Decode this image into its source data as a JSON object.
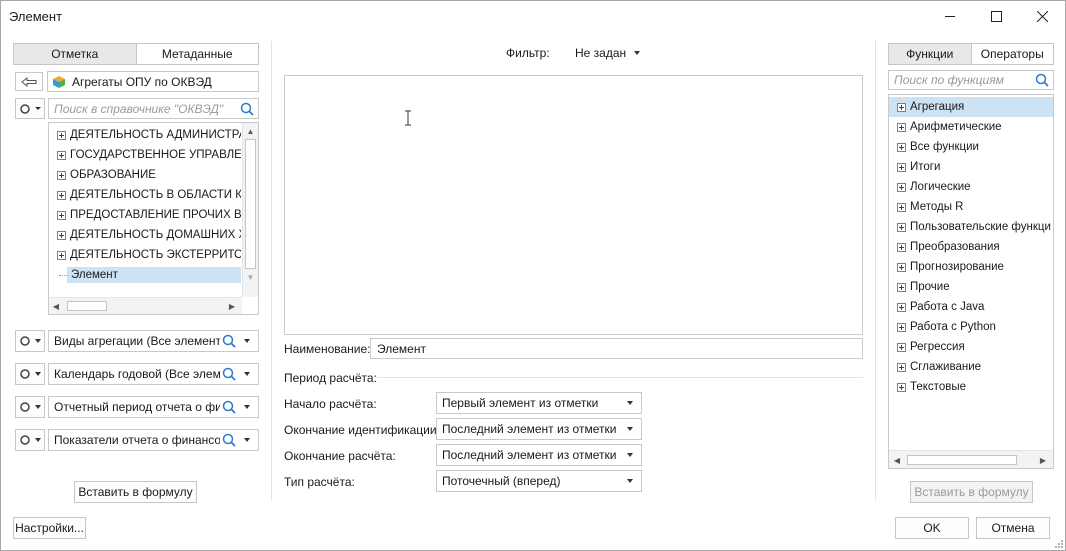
{
  "window": {
    "title": "Элемент"
  },
  "left": {
    "tabs": [
      {
        "label": "Отметка"
      },
      {
        "label": "Метаданные"
      }
    ],
    "source": {
      "label": "Агрегаты ОПУ по ОКВЭД"
    },
    "search": {
      "placeholder": "Поиск в справочнике \"ОКВЭД\""
    },
    "tree": [
      {
        "label": "ДЕЯТЕЛЬНОСТЬ АДМИНИСТРАТИ"
      },
      {
        "label": "ГОСУДАРСТВЕННОЕ УПРАВЛЕНИ"
      },
      {
        "label": "ОБРАЗОВАНИЕ"
      },
      {
        "label": "ДЕЯТЕЛЬНОСТЬ В ОБЛАСТИ КУЛЬ"
      },
      {
        "label": "ПРЕДОСТАВЛЕНИЕ ПРОЧИХ ВИД"
      },
      {
        "label": "ДЕЯТЕЛЬНОСТЬ ДОМАШНИХ ХОЗ"
      },
      {
        "label": "ДЕЯТЕЛЬНОСТЬ ЭКСТЕРРИТОРИА"
      }
    ],
    "tree_selected": "Элемент",
    "dimensions": [
      {
        "label": "Виды агрегации (Все элементы)"
      },
      {
        "label": "Календарь годовой (Все элемент"
      },
      {
        "label": "Отчетный период отчета о фина"
      },
      {
        "label": "Показатели отчета о финансовь"
      }
    ],
    "insert_button": "Вставить в формулу"
  },
  "center": {
    "filter_label": "Фильтр:",
    "filter_value": "Не задан",
    "name_label": "Наименование:",
    "name_value": "Элемент",
    "period_section": "Период расчёта:",
    "rows": [
      {
        "label": "Начало расчёта:",
        "value": "Первый элемент из отметки"
      },
      {
        "label": "Окончание идентификации:",
        "value": "Последний элемент из отметки"
      },
      {
        "label": "Окончание расчёта:",
        "value": "Последний элемент из отметки"
      },
      {
        "label": "Тип расчёта:",
        "value": "Поточечный (вперед)"
      }
    ]
  },
  "right": {
    "tabs": [
      {
        "label": "Функции"
      },
      {
        "label": "Операторы"
      }
    ],
    "search": {
      "placeholder": "Поиск по функциям"
    },
    "groups": [
      {
        "label": "Агрегация"
      },
      {
        "label": "Арифметические"
      },
      {
        "label": "Все функции"
      },
      {
        "label": "Итоги"
      },
      {
        "label": "Логические"
      },
      {
        "label": "Методы R"
      },
      {
        "label": "Пользовательские функци"
      },
      {
        "label": "Преобразования"
      },
      {
        "label": "Прогнозирование"
      },
      {
        "label": "Прочие"
      },
      {
        "label": "Работа с Java"
      },
      {
        "label": "Работа с Python"
      },
      {
        "label": "Регрессия"
      },
      {
        "label": "Сглаживание"
      },
      {
        "label": "Текстовые"
      }
    ],
    "insert_button": "Вставить в формулу"
  },
  "footer": {
    "settings_button": "Настройки...",
    "ok_button": "OK",
    "cancel_button": "Отмена"
  },
  "colors": {
    "selection": "#cde3f4",
    "active_tab": "#e8e8e8",
    "border": "#c9c9c9"
  },
  "icons": [
    "minimize-icon",
    "maximize-icon",
    "close-icon",
    "back-arrow-icon",
    "cube-icon",
    "gear-icon",
    "search-icon",
    "chevron-down-icon",
    "plus-expand-icon",
    "text-cursor-icon",
    "resize-grip-icon"
  ]
}
